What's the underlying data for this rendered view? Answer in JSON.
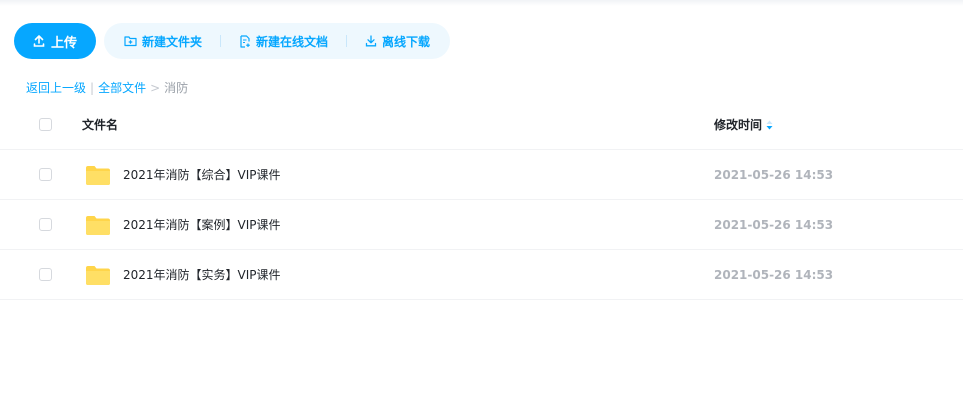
{
  "toolbar": {
    "upload_label": "上传",
    "actions": [
      {
        "label": "新建文件夹",
        "icon": "new-folder-icon"
      },
      {
        "label": "新建在线文档",
        "icon": "new-doc-icon"
      },
      {
        "label": "离线下载",
        "icon": "download-icon"
      }
    ]
  },
  "breadcrumb": {
    "back": "返回上一级",
    "divider": "|",
    "all_files": "全部文件",
    "arrow": ">",
    "current": "消防"
  },
  "table": {
    "headers": {
      "name": "文件名",
      "modified": "修改时间"
    },
    "rows": [
      {
        "name": "2021年消防【综合】VIP课件",
        "modified": "2021-05-26 14:53",
        "type": "folder"
      },
      {
        "name": "2021年消防【案例】VIP课件",
        "modified": "2021-05-26 14:53",
        "type": "folder"
      },
      {
        "name": "2021年消防【实务】VIP课件",
        "modified": "2021-05-26 14:53",
        "type": "folder"
      }
    ]
  },
  "colors": {
    "accent": "#06a7ff",
    "accent_bg": "#eef8fe",
    "folder": "#ffd54a",
    "muted_text": "#b0b4bb"
  }
}
